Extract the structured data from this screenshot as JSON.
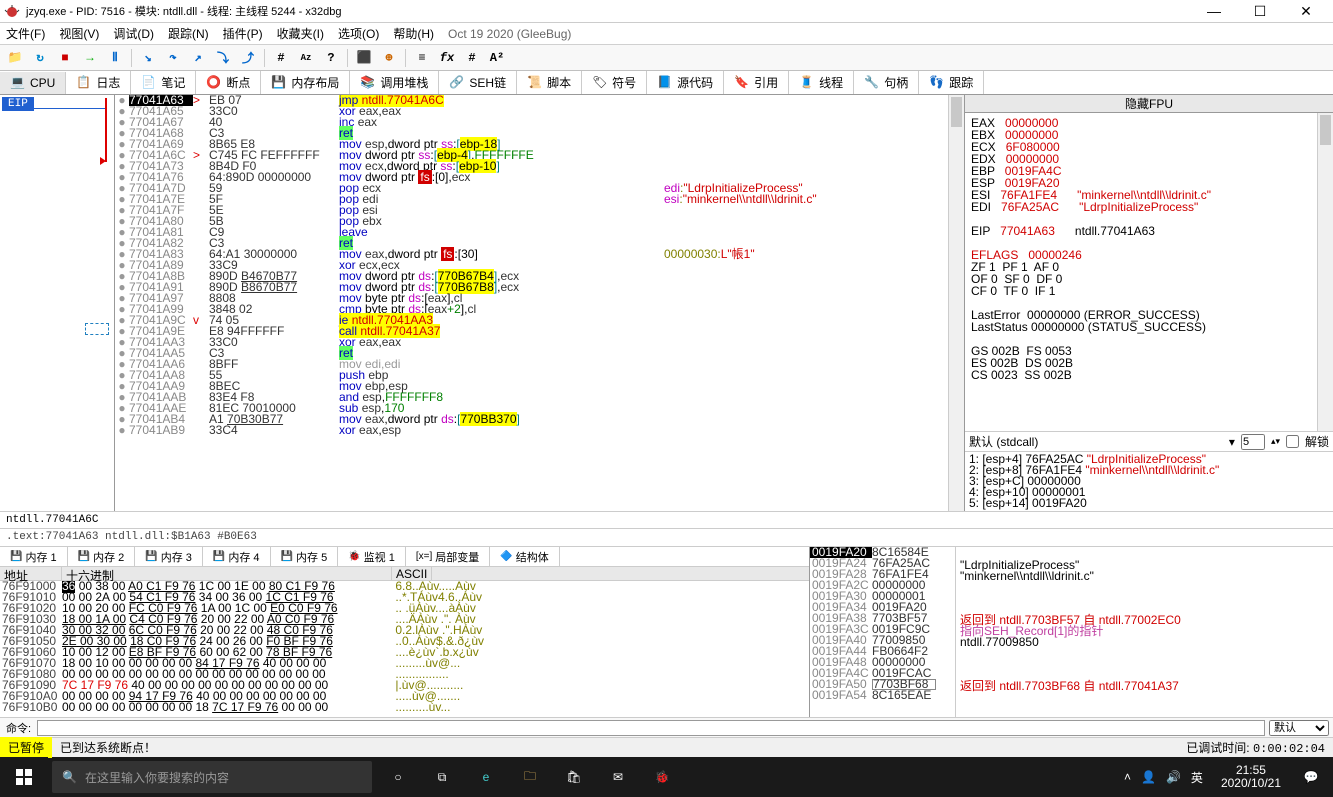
{
  "title": "jzyq.exe - PID: 7516 - 模块: ntdll.dll - 线程: 主线程 5244 - x32dbg",
  "menu": [
    "文件(F)",
    "视图(V)",
    "调试(D)",
    "跟踪(N)",
    "插件(P)",
    "收藏夹(I)",
    "选项(O)",
    "帮助(H)"
  ],
  "menuDate": "Oct 19 2020 (GleeBug)",
  "tabs": [
    "CPU",
    "日志",
    "笔记",
    "断点",
    "内存布局",
    "调用堆栈",
    "SEH链",
    "脚本",
    "符号",
    "源代码",
    "引用",
    "线程",
    "句柄",
    "跟踪"
  ],
  "eip": "EIP",
  "disasm": [
    {
      "a": "77041A63",
      "sel": 1,
      "j": ">",
      "b": "EB 07",
      "i": [
        [
          "mnm hl-y",
          "jmp "
        ],
        [
          "red hl-y",
          "ntdll.77041A6C"
        ]
      ]
    },
    {
      "a": "77041A65",
      "b": "33C0",
      "i": [
        [
          "mnm",
          "xor "
        ],
        [
          "reg",
          "eax"
        ],
        [
          "",
          ","
        ],
        [
          "reg",
          "eax"
        ]
      ]
    },
    {
      "a": "77041A67",
      "b": "40",
      "i": [
        [
          "mnm",
          "inc "
        ],
        [
          "reg",
          "eax"
        ]
      ]
    },
    {
      "a": "77041A68",
      "b": "C3",
      "i": [
        [
          "mnm hl-g",
          "ret"
        ]
      ]
    },
    {
      "a": "77041A69",
      "b": "8B65 E8",
      "i": [
        [
          "mnm",
          "mov "
        ],
        [
          "reg",
          "esp"
        ],
        [
          "",
          ",dword ptr "
        ],
        [
          "seg",
          "ss"
        ],
        [
          "",
          ":"
        ],
        [
          "brk",
          "["
        ],
        [
          "hl-y",
          "ebp-18"
        ],
        [
          "brk",
          "]"
        ]
      ]
    },
    {
      "a": "77041A6C",
      "j": ">",
      "b": "C745 FC FEFFFFFF",
      "i": [
        [
          "mnm",
          "mov "
        ],
        [
          "",
          "dword ptr "
        ],
        [
          "seg",
          "ss"
        ],
        [
          "",
          ":"
        ],
        [
          "brk",
          "["
        ],
        [
          "hl-y",
          "ebp-4"
        ],
        [
          "brk",
          "]"
        ],
        [
          "",
          ","
        ],
        [
          "num",
          "FFFFFFFE"
        ]
      ]
    },
    {
      "a": "77041A73",
      "b": "8B4D F0",
      "i": [
        [
          "mnm",
          "mov "
        ],
        [
          "reg",
          "ecx"
        ],
        [
          "",
          ",dword ptr "
        ],
        [
          "seg",
          "ss"
        ],
        [
          "",
          ":"
        ],
        [
          "brk",
          "["
        ],
        [
          "hl-y",
          "ebp-10"
        ],
        [
          "brk",
          "]"
        ]
      ]
    },
    {
      "a": "77041A76",
      "b": "64:890D 00000000",
      "i": [
        [
          "mnm",
          "mov "
        ],
        [
          "",
          "dword ptr "
        ],
        [
          "fsbox",
          "fs"
        ],
        [
          "",
          ":[0],"
        ],
        [
          "reg",
          "ecx"
        ]
      ]
    },
    {
      "a": "77041A7D",
      "b": "59",
      "i": [
        [
          "mnm",
          "pop "
        ],
        [
          "reg",
          "ecx"
        ]
      ],
      "c": [
        [
          "reg",
          "edi"
        ],
        [
          "",
          ":"
        ],
        [
          "str",
          "\"LdrpInitializeProcess\""
        ]
      ]
    },
    {
      "a": "77041A7E",
      "b": "5F",
      "i": [
        [
          "mnm",
          "pop "
        ],
        [
          "reg",
          "edi"
        ]
      ],
      "c": [
        [
          "reg",
          "esi"
        ],
        [
          "",
          ":"
        ],
        [
          "str",
          "\"minkernel\\\\ntdll\\\\ldrinit.c\""
        ]
      ]
    },
    {
      "a": "77041A7F",
      "b": "5E",
      "i": [
        [
          "mnm",
          "pop "
        ],
        [
          "reg",
          "esi"
        ]
      ]
    },
    {
      "a": "77041A80",
      "b": "5B",
      "i": [
        [
          "mnm",
          "pop "
        ],
        [
          "reg",
          "ebx"
        ]
      ]
    },
    {
      "a": "77041A81",
      "b": "C9",
      "i": [
        [
          "mnm",
          "leave"
        ]
      ]
    },
    {
      "a": "77041A82",
      "b": "C3",
      "i": [
        [
          "mnm hl-g",
          "ret"
        ]
      ]
    },
    {
      "a": "77041A83",
      "b": "64:A1 30000000",
      "i": [
        [
          "mnm",
          "mov "
        ],
        [
          "reg",
          "eax"
        ],
        [
          "",
          ",dword ptr "
        ],
        [
          "fsbox",
          "fs"
        ],
        [
          "",
          ":[30]"
        ]
      ],
      "c": [
        [
          "",
          "00000030:"
        ],
        [
          "str",
          "L\"帳1\""
        ]
      ]
    },
    {
      "a": "77041A89",
      "b": "33C9",
      "i": [
        [
          "mnm",
          "xor "
        ],
        [
          "reg",
          "ecx"
        ],
        [
          "",
          ","
        ],
        [
          "reg",
          "ecx"
        ]
      ]
    },
    {
      "a": "77041A8B",
      "b": "890D ",
      "bu": "B4670B77",
      "i": [
        [
          "mnm",
          "mov "
        ],
        [
          "",
          "dword ptr "
        ],
        [
          "seg",
          "ds"
        ],
        [
          "",
          ":"
        ],
        [
          "brk",
          "["
        ],
        [
          "hl-y",
          "770B67B4"
        ],
        [
          "brk",
          "]"
        ],
        [
          "",
          ","
        ],
        [
          "reg",
          "ecx"
        ]
      ]
    },
    {
      "a": "77041A91",
      "b": "890D ",
      "bu": "B8670B77",
      "i": [
        [
          "mnm",
          "mov "
        ],
        [
          "",
          "dword ptr "
        ],
        [
          "seg",
          "ds"
        ],
        [
          "",
          ":"
        ],
        [
          "brk",
          "["
        ],
        [
          "hl-y",
          "770B67B8"
        ],
        [
          "brk",
          "]"
        ],
        [
          "",
          ","
        ],
        [
          "reg",
          "ecx"
        ]
      ]
    },
    {
      "a": "77041A97",
      "b": "8808",
      "i": [
        [
          "mnm",
          "mov "
        ],
        [
          "",
          "byte ptr "
        ],
        [
          "seg",
          "ds"
        ],
        [
          "",
          ":["
        ],
        [
          "reg",
          "eax"
        ],
        [
          "",
          "],"
        ],
        [
          "reg",
          "cl"
        ]
      ]
    },
    {
      "a": "77041A99",
      "b": "3848 02",
      "i": [
        [
          "mnm",
          "cmp "
        ],
        [
          "",
          "byte ptr "
        ],
        [
          "seg",
          "ds"
        ],
        [
          "",
          ":["
        ],
        [
          "reg",
          "eax"
        ],
        [
          "num",
          "+2"
        ],
        [
          "",
          "],"
        ],
        [
          "reg",
          "cl"
        ]
      ]
    },
    {
      "a": "77041A9C",
      "j": "v",
      "b": "74 05",
      "i": [
        [
          "mnm hl-y",
          "je "
        ],
        [
          "red hl-y",
          "ntdll.77041AA3"
        ]
      ]
    },
    {
      "a": "77041A9E",
      "b": "E8 94FFFFFF",
      "i": [
        [
          "mnm hl-y",
          "call "
        ],
        [
          "red hl-y",
          "ntdll.77041A37"
        ]
      ]
    },
    {
      "a": "77041AA3",
      "b": "33C0",
      "i": [
        [
          "mnm",
          "xor "
        ],
        [
          "reg",
          "eax"
        ],
        [
          "",
          ","
        ],
        [
          "reg",
          "eax"
        ]
      ]
    },
    {
      "a": "77041AA5",
      "b": "C3",
      "i": [
        [
          "mnm hl-g",
          "ret"
        ]
      ]
    },
    {
      "a": "77041AA6",
      "b": "8BFF",
      "i": [
        [
          "",
          "mov edi,edi"
        ]
      ],
      "gray": 1
    },
    {
      "a": "77041AA8",
      "b": "55",
      "i": [
        [
          "mnm",
          "push "
        ],
        [
          "reg",
          "ebp"
        ]
      ]
    },
    {
      "a": "77041AA9",
      "b": "8BEC",
      "i": [
        [
          "mnm",
          "mov "
        ],
        [
          "reg",
          "ebp"
        ],
        [
          "",
          ","
        ],
        [
          "reg",
          "esp"
        ]
      ]
    },
    {
      "a": "77041AAB",
      "b": "83E4 F8",
      "i": [
        [
          "mnm",
          "and "
        ],
        [
          "reg",
          "esp"
        ],
        [
          "",
          ","
        ],
        [
          "num",
          "FFFFFFF8"
        ]
      ]
    },
    {
      "a": "77041AAE",
      "b": "81EC 70010000",
      "i": [
        [
          "mnm",
          "sub "
        ],
        [
          "reg",
          "esp"
        ],
        [
          "",
          ","
        ],
        [
          "num",
          "170"
        ]
      ]
    },
    {
      "a": "77041AB4",
      "b": "A1 ",
      "bu": "70B30B77",
      "i": [
        [
          "mnm",
          "mov "
        ],
        [
          "reg",
          "eax"
        ],
        [
          "",
          ",dword ptr "
        ],
        [
          "seg",
          "ds"
        ],
        [
          "",
          ":"
        ],
        [
          "brk",
          "["
        ],
        [
          "hl-y",
          "770BB370"
        ],
        [
          "brk",
          "]"
        ]
      ]
    },
    {
      "a": "77041AB9",
      "b": "33C4",
      "i": [
        [
          "mnm",
          "xor "
        ],
        [
          "reg",
          "eax"
        ],
        [
          "",
          ","
        ],
        [
          "reg",
          "esp"
        ]
      ]
    }
  ],
  "infobar": "ntdll.77041A6C",
  "textinfo": ".text:77041A63 ntdll.dll:$B1A63 #B0E63",
  "fpuHdr": "隐藏FPU",
  "regs": {
    "core": [
      [
        "EAX",
        "00000000"
      ],
      [
        "EBX",
        "00000000"
      ],
      [
        "ECX",
        "6F080000"
      ],
      [
        "EDX",
        "00000000"
      ],
      [
        "EBP",
        "0019FA4C"
      ],
      [
        "ESP",
        "0019FA20"
      ],
      [
        "ESI",
        "76FA1FE4",
        "\"minkernel\\\\ntdll\\\\ldrinit.c\""
      ],
      [
        "EDI",
        "76FA25AC",
        "\"LdrpInitializeProcess\""
      ]
    ],
    "eip": [
      "EIP",
      "77041A63",
      "ntdll.77041A63"
    ],
    "eflags": "EFLAGS   00000246",
    "flags": [
      "ZF 1  PF 1  AF 0",
      "OF 0  SF 0  DF 0",
      "CF 0  TF 0  IF 1"
    ],
    "err": [
      "LastError  00000000 (ERROR_SUCCESS)",
      "LastStatus 00000000 (STATUS_SUCCESS)"
    ],
    "seg": [
      "GS 002B  FS 0053",
      "ES 002B  DS 002B",
      "CS 0023  SS 002B"
    ]
  },
  "callconv": {
    "label": "默认 (stdcall)",
    "spin": "5",
    "unlock": "解锁"
  },
  "stackArgs": [
    "1: [esp+4] 76FA25AC \"LdrpInitializeProcess\"",
    "2: [esp+8] 76FA1FE4 \"minkernel\\\\ntdll\\\\ldrinit.c\"",
    "3: [esp+C] 00000000",
    "4: [esp+10] 00000001",
    "5: [esp+14] 0019FA20"
  ],
  "memtabs": [
    "内存 1",
    "内存 2",
    "内存 3",
    "内存 4",
    "内存 5",
    "监视 1",
    "局部变量",
    "结构体"
  ],
  "memhdr": {
    "addr": "地址",
    "hex": "十六进制",
    "asc": "ASCII"
  },
  "memrows": [
    {
      "a": "76F91000",
      "h": [
        [
          "sel",
          "36"
        ],
        [
          "",
          " 00 38 00 "
        ],
        [
          "ul",
          "A0 C1 F9 76"
        ],
        [
          "",
          " 1C 00 1E 00 "
        ],
        [
          "ul",
          "80 C1 F9 76"
        ]
      ],
      "s": "6.8..Áùv.....Áùv"
    },
    {
      "a": "76F91010",
      "h": [
        [
          "",
          "00 00 2A 00 "
        ],
        [
          "ul",
          "54 C1 F9 76"
        ],
        [
          "",
          " 34 00 36 00 "
        ],
        [
          "ul",
          "1C C1 F9 76"
        ]
      ],
      "s": "..*.TÁùv4.6..Áùv"
    },
    {
      "a": "76F91020",
      "h": [
        [
          "",
          "10 00 20 00 "
        ],
        [
          "ul",
          "FC C0 F9 76"
        ],
        [
          "",
          " 1A 00 1C 00 "
        ],
        [
          "ul",
          "E0 C0 F9 76"
        ]
      ],
      "s": ".. .üÀùv....àÀùv"
    },
    {
      "a": "76F91030",
      "h": [
        [
          "ul",
          "18 00 1A 00"
        ],
        [
          "",
          " "
        ],
        [
          "ul",
          "C4 C0 F9 76"
        ],
        [
          "",
          " 20 00 22 00 "
        ],
        [
          "ul",
          "A0 C0 F9 76"
        ]
      ],
      "s": "....ÄÀùv .\". Àùv"
    },
    {
      "a": "76F91040",
      "h": [
        [
          "ul",
          "30 00 32 00"
        ],
        [
          "",
          " "
        ],
        [
          "ul",
          "6C C0 F9 76"
        ],
        [
          "",
          " 20 00 22 00 "
        ],
        [
          "ul",
          "48 C0 F9 76"
        ]
      ],
      "s": "0.2.lÀùv .\".HÀùv"
    },
    {
      "a": "76F91050",
      "h": [
        [
          "ul",
          "2E 00 30 00"
        ],
        [
          "",
          " "
        ],
        [
          "ul",
          "18 C0 F9 76"
        ],
        [
          "",
          " 24 00 26 00 "
        ],
        [
          "ul",
          "F0 BF F9 76"
        ]
      ],
      "s": "..0..Àùv$.&.ð¿ùv"
    },
    {
      "a": "76F91060",
      "h": [
        [
          "",
          "10 00 12 00 "
        ],
        [
          "ul",
          "E8 BF F9 76"
        ],
        [
          "",
          " 60 00 62 00 "
        ],
        [
          "ul",
          "78 BF F9 76"
        ]
      ],
      "s": "....è¿ùv`.b.x¿ùv"
    },
    {
      "a": "76F91070",
      "h": [
        [
          "",
          "18 00 10 00 00 00 00 00 "
        ],
        [
          "ul",
          "84 17 F9 76"
        ],
        [
          "",
          " 40 00 00 00"
        ]
      ],
      "s": ".........ùv@..."
    },
    {
      "a": "76F91080",
      "h": [
        [
          "",
          "00 00 00 00 00 00 00 00 00 00 00 00 00 00 00 00"
        ]
      ],
      "s": "................"
    },
    {
      "a": "76F91090",
      "h": [
        [
          "red",
          "7C 17 F9 76"
        ],
        [
          "",
          " 40 00 00 00 00 00 00 00 00 00 00 00"
        ]
      ],
      "s": "|.ùv@..........."
    },
    {
      "a": "76F910A0",
      "h": [
        [
          "",
          "00 00 00 00 "
        ],
        [
          "ul",
          "94 17 F9 76"
        ],
        [
          "",
          " 40 00 00 00 00 00 00 00"
        ]
      ],
      "s": ".....ùv@......."
    },
    {
      "a": "76F910B0",
      "h": [
        [
          "",
          "00 00 00 00 00 00 00 00 18 "
        ],
        [
          "ul",
          "7C 17 F9 76"
        ],
        [
          "",
          " 00 00 00"
        ]
      ],
      "s": "..........ùv..."
    }
  ],
  "stack": [
    {
      "a": "0019FA20",
      "sel": 1,
      "v": "8C16584E"
    },
    {
      "a": "0019FA24",
      "v": "76FA25AC",
      "s": "\"LdrpInitializeProcess\""
    },
    {
      "a": "0019FA28",
      "v": "76FA1FE4",
      "s": "\"minkernel\\\\ntdll\\\\ldrinit.c\""
    },
    {
      "a": "0019FA2C",
      "v": "00000000"
    },
    {
      "a": "0019FA30",
      "v": "00000001"
    },
    {
      "a": "0019FA34",
      "v": "0019FA20"
    },
    {
      "a": "0019FA38",
      "v": "7703BF57",
      "s": "返回到 ntdll.7703BF57 自 ntdll.77002EC0",
      "red": 1
    },
    {
      "a": "0019FA3C",
      "v": "0019FC9C",
      "s": "指向SEH_Record[1]的指针",
      "pink": 1
    },
    {
      "a": "0019FA40",
      "v": "77009850",
      "s": "ntdll.77009850"
    },
    {
      "a": "0019FA44",
      "v": "FB0664F2"
    },
    {
      "a": "0019FA48",
      "v": "00000000"
    },
    {
      "a": "0019FA4C",
      "v": "0019FCAC"
    },
    {
      "a": "0019FA50",
      "v": "7703BF68",
      "box": 1,
      "s": "返回到 ntdll.7703BF68 自 ntdll.77041A37",
      "red": 1
    },
    {
      "a": "0019FA54",
      "v": "8C165EAE"
    }
  ],
  "cmdLabel": "命令:",
  "cmdDefault": "默认",
  "status": {
    "paused": "已暂停",
    "msg": "已到达系统断点！",
    "dbg": "已调试时间:",
    "time": "0:00:02:04"
  },
  "taskbar": {
    "search": "在这里输入你要搜索的内容",
    "ime": "英",
    "time": "21:55",
    "date": "2020/10/21"
  }
}
